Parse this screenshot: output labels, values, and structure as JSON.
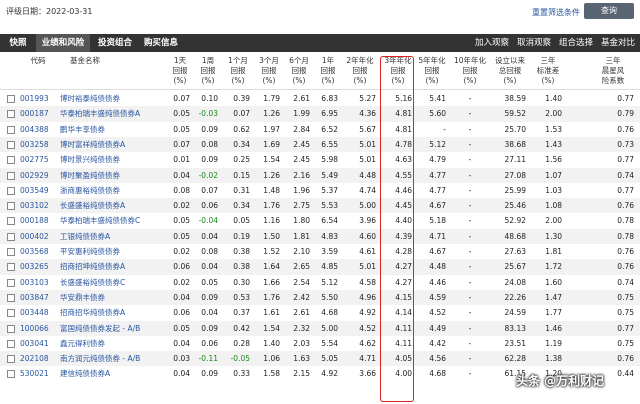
{
  "topbar": {
    "date_label": "评级日期：2022-03-31",
    "reset_label": "重置筛选条件",
    "query_label": "查询"
  },
  "tabs": [
    {
      "label": "快照",
      "active": false
    },
    {
      "label": "业绩和风险",
      "active": true
    },
    {
      "label": "投资组合",
      "active": false
    },
    {
      "label": "购买信息",
      "active": false
    }
  ],
  "actions": [
    {
      "label": "加入观察"
    },
    {
      "label": "取消观察"
    },
    {
      "label": "组合选择"
    },
    {
      "label": "基金对比"
    }
  ],
  "headers": [
    {
      "label": "代码"
    },
    {
      "label": "基金名称"
    },
    {
      "label": "1天\n回报\n(%)"
    },
    {
      "label": "1周\n回报\n(%)"
    },
    {
      "label": "1个月\n回报\n(%)"
    },
    {
      "label": "3个月\n回报\n(%)"
    },
    {
      "label": "6个月\n回报\n(%)"
    },
    {
      "label": "1年\n回报\n(%)"
    },
    {
      "label": "2年年化\n回报\n(%)"
    },
    {
      "label": "3年年化\n回报\n(%)"
    },
    {
      "label": "5年年化\n回报\n(%)"
    },
    {
      "label": "10年年化\n回报\n(%)"
    },
    {
      "label": "设立以来\n总回报\n(%)"
    },
    {
      "label": "三年\n标准差\n(%)"
    },
    {
      "label": "三年\n晨星风\n险系数"
    }
  ],
  "rows": [
    {
      "code": "001993",
      "name": "博时裕泰纯债债券",
      "v": [
        "0.07",
        "0.10",
        "0.39",
        "1.79",
        "2.61",
        "6.83",
        "5.27",
        "5.16",
        "5.41",
        "-",
        "38.59",
        "1.40",
        "0.77"
      ]
    },
    {
      "code": "000187",
      "name": "华泰柏瑞丰盛纯债债券A",
      "v": [
        "0.05",
        "-0.03",
        "0.07",
        "1.26",
        "1.99",
        "6.95",
        "4.36",
        "4.81",
        "5.60",
        "-",
        "59.52",
        "2.00",
        "0.79"
      ]
    },
    {
      "code": "004388",
      "name": "鹏华丰享债券",
      "v": [
        "0.05",
        "0.09",
        "0.62",
        "1.97",
        "2.84",
        "6.52",
        "5.67",
        "4.81",
        "-",
        "-",
        "25.70",
        "1.53",
        "0.76"
      ]
    },
    {
      "code": "003258",
      "name": "博时富祥纯债债券A",
      "v": [
        "0.07",
        "0.08",
        "0.34",
        "1.69",
        "2.45",
        "6.55",
        "5.01",
        "4.78",
        "5.12",
        "-",
        "38.68",
        "1.43",
        "0.73"
      ]
    },
    {
      "code": "002775",
      "name": "博时景兴纯债债券",
      "v": [
        "0.01",
        "0.09",
        "0.25",
        "1.54",
        "2.45",
        "5.98",
        "5.01",
        "4.63",
        "4.79",
        "-",
        "27.11",
        "1.56",
        "0.77"
      ]
    },
    {
      "code": "002929",
      "name": "博时聚盈纯债债券",
      "v": [
        "0.04",
        "-0.02",
        "0.15",
        "1.26",
        "2.16",
        "5.49",
        "4.48",
        "4.55",
        "4.77",
        "-",
        "27.08",
        "1.07",
        "0.74"
      ]
    },
    {
      "code": "003549",
      "name": "浙商惠裕纯债债券",
      "v": [
        "0.08",
        "0.07",
        "0.31",
        "1.48",
        "1.96",
        "5.37",
        "4.74",
        "4.46",
        "4.77",
        "-",
        "25.99",
        "1.03",
        "0.77"
      ]
    },
    {
      "code": "003102",
      "name": "长盛盛裕纯债债券A",
      "v": [
        "0.02",
        "0.06",
        "0.34",
        "1.76",
        "2.75",
        "5.53",
        "5.00",
        "4.45",
        "4.67",
        "-",
        "25.46",
        "1.08",
        "0.76"
      ]
    },
    {
      "code": "000188",
      "name": "华泰柏瑞丰盛纯债债券C",
      "v": [
        "0.05",
        "-0.04",
        "0.05",
        "1.16",
        "1.80",
        "6.54",
        "3.96",
        "4.40",
        "5.18",
        "-",
        "52.92",
        "2.00",
        "0.78"
      ]
    },
    {
      "code": "000402",
      "name": "工银纯债债券A",
      "v": [
        "0.05",
        "0.04",
        "0.19",
        "1.50",
        "1.81",
        "4.83",
        "4.60",
        "4.39",
        "4.71",
        "-",
        "48.68",
        "1.30",
        "0.78"
      ]
    },
    {
      "code": "003568",
      "name": "平安惠利纯债债券",
      "v": [
        "0.02",
        "0.08",
        "0.38",
        "1.52",
        "2.10",
        "3.59",
        "4.61",
        "4.28",
        "4.67",
        "-",
        "27.63",
        "1.81",
        "0.76"
      ]
    },
    {
      "code": "003265",
      "name": "招商招坤纯债债券A",
      "v": [
        "0.06",
        "0.04",
        "0.38",
        "1.64",
        "2.65",
        "4.85",
        "5.01",
        "4.27",
        "4.48",
        "-",
        "25.67",
        "1.72",
        "0.76"
      ]
    },
    {
      "code": "003103",
      "name": "长盛盛裕纯债债券C",
      "v": [
        "0.02",
        "0.05",
        "0.30",
        "1.66",
        "2.54",
        "5.12",
        "4.58",
        "4.27",
        "4.46",
        "-",
        "24.08",
        "1.60",
        "0.74"
      ]
    },
    {
      "code": "003847",
      "name": "华安鼎丰债券",
      "v": [
        "0.04",
        "0.09",
        "0.53",
        "1.76",
        "2.42",
        "5.50",
        "4.96",
        "4.15",
        "4.59",
        "-",
        "22.26",
        "1.47",
        "0.75"
      ]
    },
    {
      "code": "003448",
      "name": "招商招华纯债债券A",
      "v": [
        "0.06",
        "0.04",
        "0.37",
        "1.61",
        "2.61",
        "4.68",
        "4.92",
        "4.14",
        "4.52",
        "-",
        "24.59",
        "1.77",
        "0.75"
      ]
    },
    {
      "code": "100066",
      "name": "富国纯债债券发起 - A/B",
      "v": [
        "0.05",
        "0.09",
        "0.42",
        "1.54",
        "2.32",
        "5.00",
        "4.52",
        "4.11",
        "4.49",
        "-",
        "83.13",
        "1.46",
        "0.77"
      ]
    },
    {
      "code": "003041",
      "name": "鑫元得利债券",
      "v": [
        "0.04",
        "0.06",
        "0.28",
        "1.40",
        "2.03",
        "5.54",
        "4.62",
        "4.11",
        "4.42",
        "-",
        "23.51",
        "1.19",
        "0.75"
      ]
    },
    {
      "code": "202108",
      "name": "南方润元纯债债券 - A/B",
      "v": [
        "0.03",
        "-0.11",
        "-0.05",
        "1.06",
        "1.63",
        "5.05",
        "4.71",
        "4.05",
        "4.56",
        "-",
        "62.28",
        "1.38",
        "0.76"
      ]
    },
    {
      "code": "530021",
      "name": "建信纯债债券A",
      "v": [
        "0.04",
        "0.09",
        "0.33",
        "1.58",
        "2.15",
        "4.92",
        "3.66",
        "4.00",
        "4.68",
        "-",
        "61.15",
        "1.20",
        "0.44"
      ]
    }
  ],
  "watermark": "头条 @万利财记"
}
